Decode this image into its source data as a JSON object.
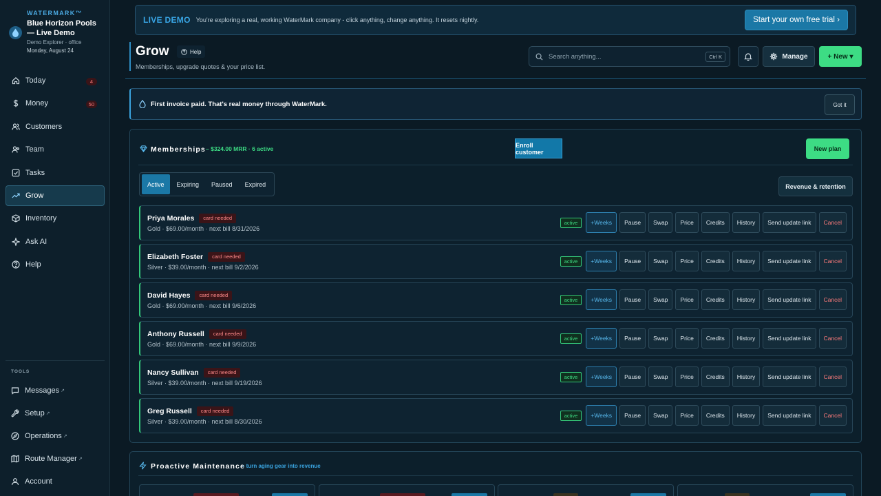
{
  "brand": {
    "small": "WATERMARK™",
    "name": "Blue Horizon Pools — Live Demo",
    "sub": "Demo Explorer · office",
    "date": "Monday, August 24"
  },
  "nav": [
    {
      "label": "Today",
      "icon": "home-icon",
      "badge": "4"
    },
    {
      "label": "Money",
      "icon": "dollar-icon",
      "badge": "50"
    },
    {
      "label": "Customers",
      "icon": "users-icon"
    },
    {
      "label": "Team",
      "icon": "team-icon"
    },
    {
      "label": "Tasks",
      "icon": "checkbox-icon"
    },
    {
      "label": "Grow",
      "icon": "trending-up-icon",
      "active": true
    },
    {
      "label": "Inventory",
      "icon": "box-icon"
    },
    {
      "label": "Ask AI",
      "icon": "sparkle-icon"
    },
    {
      "label": "Help",
      "icon": "help-icon"
    }
  ],
  "tools": {
    "label": "TOOLS",
    "items": [
      {
        "label": "Messages",
        "icon": "message-icon",
        "ext": "↗"
      },
      {
        "label": "Setup",
        "icon": "wrench-icon",
        "ext": "↗"
      },
      {
        "label": "Operations",
        "icon": "compass-icon",
        "ext": "↗"
      },
      {
        "label": "Route Manager",
        "icon": "map-icon",
        "ext": "↗"
      },
      {
        "label": "Account",
        "icon": "user-icon"
      }
    ]
  },
  "banner": {
    "live": "LIVE DEMO",
    "message": "You're exploring a real, working WaterMark company - click anything, change anything. It resets nightly.",
    "cta": "Start your own free trial ›"
  },
  "header": {
    "title": "Grow",
    "help": "Help",
    "subtitle": "Memberships, upgrade quotes & your price list.",
    "search_placeholder": "Search anything...",
    "search_shortcut": "Ctrl K",
    "manage": "Manage",
    "new": "+ New ▾"
  },
  "notice": {
    "text": "First invoice paid. That's real money through WaterMark.",
    "dismiss": "Got it"
  },
  "memberships": {
    "title": "Memberships",
    "summary": "– $324.00 MRR · 6 active",
    "enroll": "Enroll customer",
    "new_plan": "New plan",
    "tabs": [
      "Active",
      "Expiring",
      "Paused",
      "Expired"
    ],
    "active_tab": "Active",
    "revenue": "Revenue & retention",
    "badge": "card needed",
    "status": "active",
    "actions": [
      "+Weeks",
      "Pause",
      "Swap",
      "Price",
      "Credits",
      "History",
      "Send update link",
      "Cancel"
    ],
    "rows": [
      {
        "name": "Priya Morales",
        "detail": "Gold · $69.00/month · next bill 8/31/2026"
      },
      {
        "name": "Elizabeth Foster",
        "detail": "Silver · $39.00/month · next bill 9/2/2026"
      },
      {
        "name": "David Hayes",
        "detail": "Gold · $69.00/month · next bill 9/6/2026"
      },
      {
        "name": "Anthony Russell",
        "detail": "Gold · $69.00/month · next bill 9/9/2026"
      },
      {
        "name": "Nancy Sullivan",
        "detail": "Silver · $39.00/month · next bill 9/19/2026"
      },
      {
        "name": "Greg Russell",
        "detail": "Silver · $39.00/month · next bill 8/30/2026"
      }
    ]
  },
  "maintenance": {
    "title": "Proactive Maintenance",
    "subtitle": "– turn aging gear into revenue"
  },
  "colors": {
    "accent": "#1b78a6",
    "success": "#3ddc84",
    "danger": "#ff7b7b",
    "background": "#0b1a24"
  }
}
